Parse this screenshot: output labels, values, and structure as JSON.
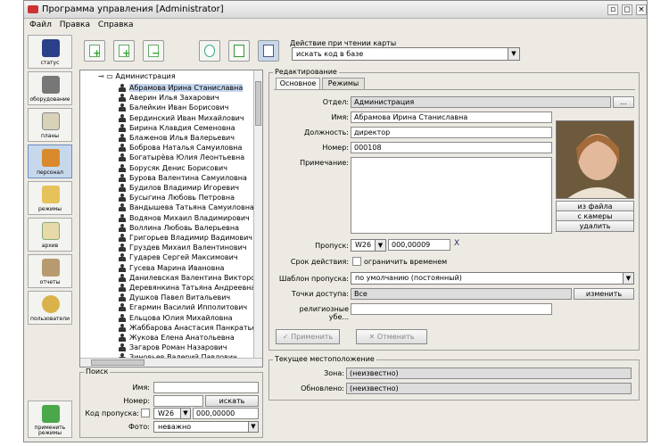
{
  "window": {
    "title": "Программа управления [Administrator]"
  },
  "menu": [
    "Файл",
    "Правка",
    "Справка"
  ],
  "leftbar": [
    {
      "label": "статус",
      "icon": "monitor-icon"
    },
    {
      "label": "оборудование",
      "icon": "hardware-icon"
    },
    {
      "label": "планы",
      "icon": "plan-icon"
    },
    {
      "label": "персонал",
      "icon": "personnel-icon"
    },
    {
      "label": "режимы",
      "icon": "folder-icon"
    },
    {
      "label": "архив",
      "icon": "clipboard-icon"
    },
    {
      "label": "отчеты",
      "icon": "report-icon"
    },
    {
      "label": "пользователи",
      "icon": "key-icon"
    }
  ],
  "apply_modes": {
    "label": "применить режимы",
    "icon": "download-arrow-icon"
  },
  "card_action": {
    "label": "Действие при чтении карты",
    "value": "искать код в базе"
  },
  "tree": {
    "root": "Администрация",
    "items": [
      "Абрамова Ирина Станиславна",
      "Аверин Илья Захарович",
      "Балейкин Иван Борисович",
      "Бердинский Иван Михайлович",
      "Бирина Клавдия Семеновна",
      "Блаженов Илья Валерьевич",
      "Боброва Наталья Самуиловна",
      "Богатырёва Юлия Леонтьевна",
      "Борусяк Денис Борисович",
      "Бурова Валентина Самуиловна",
      "Будилов Владимир Игоревич",
      "Бусыгина Любовь Петровна",
      "Вандышева Татьяна Самуиловна",
      "Водянов Михаил Владимирович",
      "Воллина Любовь Валерьевна",
      "Григорьев Владимир Вадимович",
      "Груздев Михаил Валентинович",
      "Гударев Сергей Максимович",
      "Гусева Марина Ивановна",
      "Данилевская Валентина Викторовна",
      "Деревянкина Татьяна Андреевна",
      "Душков Павел Витальевич",
      "Егармин Василий Ипполитович",
      "Ельцова Юлия Михайловна",
      "Жаббарова Анастасия Панкратьевна",
      "Жукова Елена Анатольевна",
      "Загаров Роман Назарович",
      "Зиновьев Валерий Павлович"
    ]
  },
  "search": {
    "title": "Поиск",
    "name_label": "Имя:",
    "number_label": "Номер:",
    "search_button": "искать",
    "pass_code_label": "Код пропуска:",
    "pass_prefix": "W26",
    "pass_code": "000,00000",
    "photo_label": "Фото:",
    "photo_value": "неважно"
  },
  "edit": {
    "group_title": "Редактирование",
    "tabs": [
      "Основное",
      "Режимы"
    ],
    "department_label": "Отдел:",
    "department_value": "Администрация",
    "dots_button": "...",
    "name_label": "Имя:",
    "name_value": "Абрамова Ирина Станиславна",
    "position_label": "Должность:",
    "position_value": "директор",
    "number_label": "Номер:",
    "number_value": "000108",
    "note_label": "Примечание:",
    "pass_label": "Пропуск:",
    "pass_prefix": "W26",
    "pass_value": "000,00009",
    "pass_clear": "X",
    "validity_label": "Срок действия:",
    "validity_checkbox": "ограничить временем",
    "template_label": "Шаблон пропуска:",
    "template_value": "по умолчанию (постоянный)",
    "access_label": "Точки доступа:",
    "access_value": "Все",
    "change_button": "изменить",
    "religion_label": "религиозные убе...",
    "photo_from_file": "из файла",
    "photo_from_camera": "с камеры",
    "photo_delete": "удалить",
    "apply_button": "Применить",
    "cancel_button": "Отменить"
  },
  "location": {
    "title": "Текущее местоположение",
    "zone_label": "Зона:",
    "zone_value": "(неизвестно)",
    "updated_label": "Обновлено:",
    "updated_value": "(неизвестно)"
  }
}
